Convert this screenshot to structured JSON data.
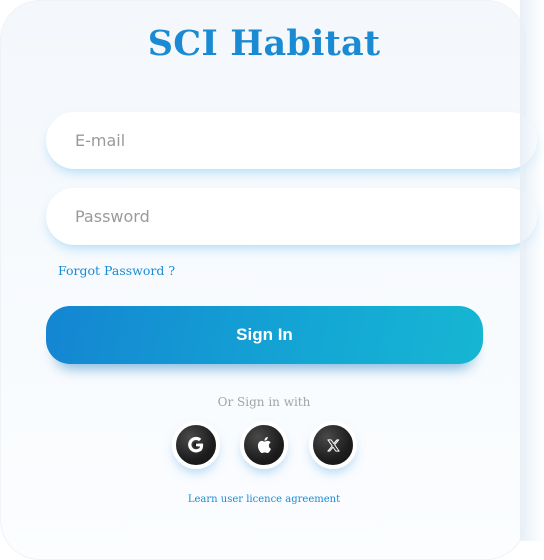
{
  "app": {
    "title": "SCI Habitat"
  },
  "form": {
    "email_placeholder": "E-mail",
    "password_placeholder": "Password",
    "forgot_label": "Forgot Password ?",
    "signin_label": "Sign In"
  },
  "social": {
    "prompt": "Or Sign in with",
    "providers": [
      {
        "name": "Google",
        "icon": "google-icon"
      },
      {
        "name": "Apple",
        "icon": "apple-icon"
      },
      {
        "name": "X",
        "icon": "x-icon"
      }
    ]
  },
  "footer": {
    "licence_label": "Learn user licence agreement"
  },
  "colors": {
    "brand": "#1a8bd3",
    "button_gradient_start": "#1485d2",
    "button_gradient_end": "#16b6d3",
    "social_button": "#1d1d1d"
  }
}
